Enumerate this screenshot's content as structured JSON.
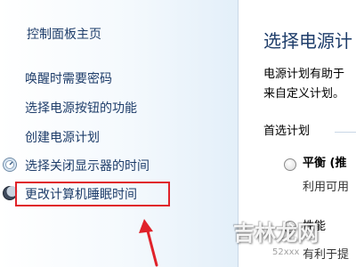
{
  "sidebar": {
    "home_label": "控制面板主页",
    "items": [
      {
        "label": "唤醒时需要密码"
      },
      {
        "label": "选择电源按钮的功能"
      },
      {
        "label": "创建电源计划"
      },
      {
        "label": "选择关闭显示器的时间",
        "icon": "monitor-icon"
      },
      {
        "label": "更改计算机睡眠时间",
        "icon": "moon-icon",
        "highlighted": true
      }
    ]
  },
  "main": {
    "title": "选择电源计",
    "description_line1": "电源计划有助于",
    "description_line2": "来自定义计划。",
    "section_label": "首选计划",
    "plans": [
      {
        "name": "平衡 (推",
        "description": "利用可用"
      },
      {
        "name": "性能",
        "description": "有利于提"
      }
    ]
  },
  "watermark": {
    "text": "吉林龙网",
    "small_text": "52xxx"
  },
  "colors": {
    "link": "#1e3d6a",
    "highlight_border": "#e0222a",
    "arrow": "#e0222a"
  }
}
